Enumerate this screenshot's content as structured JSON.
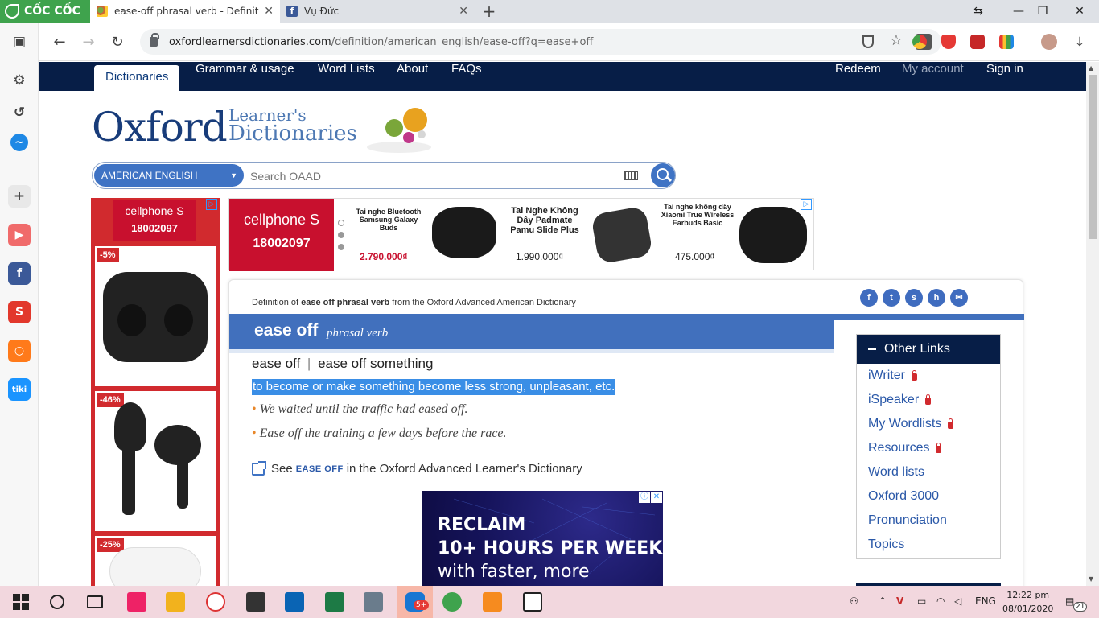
{
  "browser": {
    "brand": "CỐC CỐC",
    "tabs": [
      {
        "title": "ease-off phrasal verb - Definition, pictures, pronunciation and usage notes",
        "icon": "oald-icon"
      },
      {
        "title": "Vụ Đức",
        "icon": "facebook-icon"
      }
    ],
    "url_host": "oxfordlearnersdictionaries.com",
    "url_path": "/definition/american_english/ease-off?q=ease+off"
  },
  "site": {
    "nav": {
      "dictionaries": "Dictionaries",
      "grammar": "Grammar & usage",
      "wordlists": "Word Lists",
      "about": "About",
      "faqs": "FAQs",
      "redeem": "Redeem",
      "myaccount": "My account",
      "signin": "Sign in"
    },
    "logo": {
      "oxford": "Oxford",
      "learners": "Learner's",
      "dictionaries": "Dictionaries"
    },
    "search": {
      "dictionary": "AMERICAN ENGLISH",
      "placeholder": "Search OAAD"
    }
  },
  "ads": {
    "left": {
      "brand": "cellphone S",
      "phone": "18002097",
      "badges": [
        "-5%",
        "-46%",
        "-25%"
      ]
    },
    "top": {
      "brand": "cellphone S",
      "phone": "18002097",
      "products": [
        {
          "name": "Tai nghe Bluetooth Samsung Galaxy Buds",
          "price": "2.790.000₫"
        },
        {
          "name": "Tai Nghe Không Dây Padmate Pamu Slide Plus",
          "price": "1.990.000₫"
        },
        {
          "name": "Tai nghe không dây Xiaomi True Wireless Earbuds Basic",
          "price": "475.000₫"
        }
      ]
    },
    "bottom": {
      "line1": "RECLAIM",
      "line2": "10+ HOURS PER WEEK",
      "line3": "with faster, more"
    }
  },
  "entry": {
    "def_prefix": "Definition of ",
    "def_term": "ease off phrasal verb",
    "def_suffix": " from the Oxford Advanced American Dictionary",
    "headword": "ease off",
    "pos": "phrasal verb",
    "phrase_a": "ease off",
    "phrase_sep": "|",
    "phrase_b": "ease off something",
    "definition": "to become or make something become less strong, unpleasant, etc.",
    "examples": [
      "We waited until the traffic had eased off.",
      "Ease off the training a few days before the race."
    ],
    "see_prefix": "See",
    "see_link": "EASE OFF",
    "see_suffix": "in the Oxford Advanced Learner's Dictionary"
  },
  "other_links": {
    "title": "Other Links",
    "items": [
      {
        "label": "iWriter",
        "locked": true
      },
      {
        "label": "iSpeaker",
        "locked": true
      },
      {
        "label": "My Wordlists",
        "locked": true
      },
      {
        "label": "Resources",
        "locked": true
      },
      {
        "label": "Word lists",
        "locked": false
      },
      {
        "label": "Oxford 3000",
        "locked": false
      },
      {
        "label": "Pronunciation",
        "locked": false
      },
      {
        "label": "Topics",
        "locked": false
      }
    ]
  },
  "taskbar": {
    "lang": "ENG",
    "time": "12:22 pm",
    "date": "08/01/2020",
    "notifications": "21",
    "zalo_badge": "5+"
  }
}
